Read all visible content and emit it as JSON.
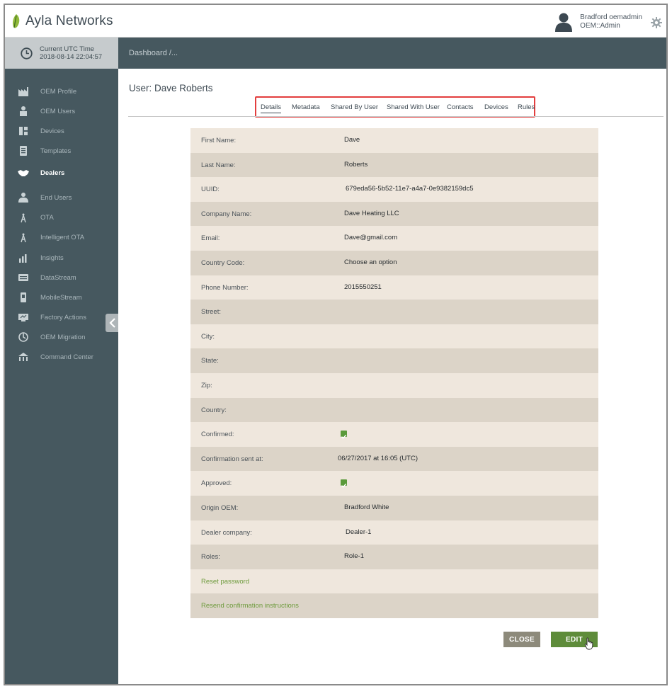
{
  "header": {
    "brand": "Ayla Networks",
    "user_name": "Bradford oemadmin",
    "user_role": "OEM::Admin",
    "icons": [
      "leaf-logo-icon",
      "user-avatar-icon",
      "gear-icon"
    ]
  },
  "clock": {
    "label": "Current UTC Time",
    "value": "2018-08-14 22:04:57"
  },
  "sidebar": {
    "items": [
      {
        "label": "OEM Profile",
        "icon": "factory-icon"
      },
      {
        "label": "OEM Users",
        "icon": "users-icon"
      },
      {
        "label": "Devices",
        "icon": "devices-icon"
      },
      {
        "label": "Templates",
        "icon": "template-icon"
      },
      {
        "label": "Dealers",
        "icon": "handshake-icon",
        "active": true
      },
      {
        "label": "End Users",
        "icon": "end-users-icon"
      },
      {
        "label": "OTA",
        "icon": "antenna-icon"
      },
      {
        "label": "Intelligent OTA",
        "icon": "antenna-icon"
      },
      {
        "label": "Insights",
        "icon": "bar-chart-icon"
      },
      {
        "label": "DataStream",
        "icon": "stream-icon"
      },
      {
        "label": "MobileStream",
        "icon": "mobile-icon"
      },
      {
        "label": "Factory Actions",
        "icon": "factory-actions-icon"
      },
      {
        "label": "OEM Migration",
        "icon": "migration-icon"
      },
      {
        "label": "Command Center",
        "icon": "command-center-icon"
      }
    ]
  },
  "breadcrumb": "Dashboard /...",
  "page": {
    "title": "User: Dave Roberts",
    "tabs": [
      "Details",
      "Metadata",
      "Shared By User",
      "Shared With User",
      "Contacts",
      "Devices",
      "Rules"
    ],
    "active_tab": "Details"
  },
  "details": [
    {
      "label": "First Name:",
      "value": "Dave"
    },
    {
      "label": "Last Name:",
      "value": "Roberts"
    },
    {
      "label": "UUID:",
      "value": "679eda56-5b52-11e7-a4a7-0e9382159dc5"
    },
    {
      "label": "Company Name:",
      "value": "Dave Heating LLC"
    },
    {
      "label": "Email:",
      "value": "Dave@gmail.com"
    },
    {
      "label": "Country Code:",
      "value": "Choose an option"
    },
    {
      "label": "Phone Number:",
      "value": "2015550251"
    },
    {
      "label": "Street:",
      "value": ""
    },
    {
      "label": "City:",
      "value": ""
    },
    {
      "label": "State:",
      "value": ""
    },
    {
      "label": "Zip:",
      "value": ""
    },
    {
      "label": "Country:",
      "value": ""
    },
    {
      "label": "Confirmed:",
      "checked": true
    },
    {
      "label": "Confirmation sent at:",
      "value": "06/27/2017 at 16:05 (UTC)"
    },
    {
      "label": "Approved:",
      "checked": true
    },
    {
      "label": "Origin OEM:",
      "value": "Bradford White"
    },
    {
      "label": "Dealer company:",
      "value": "Dealer-1"
    },
    {
      "label": "Roles:",
      "value": "Role-1"
    }
  ],
  "links": {
    "reset_password": "Reset password",
    "resend_confirmation": "Resend confirmation instructions"
  },
  "buttons": {
    "close": "CLOSE",
    "edit": "EDIT"
  },
  "colors": {
    "sidebar_bg": "#46585f",
    "accent_green": "#5e8c3a",
    "tab_highlight": "#e33e3e",
    "row_light": "#efe7dd",
    "row_dark": "#dcd4c8"
  }
}
